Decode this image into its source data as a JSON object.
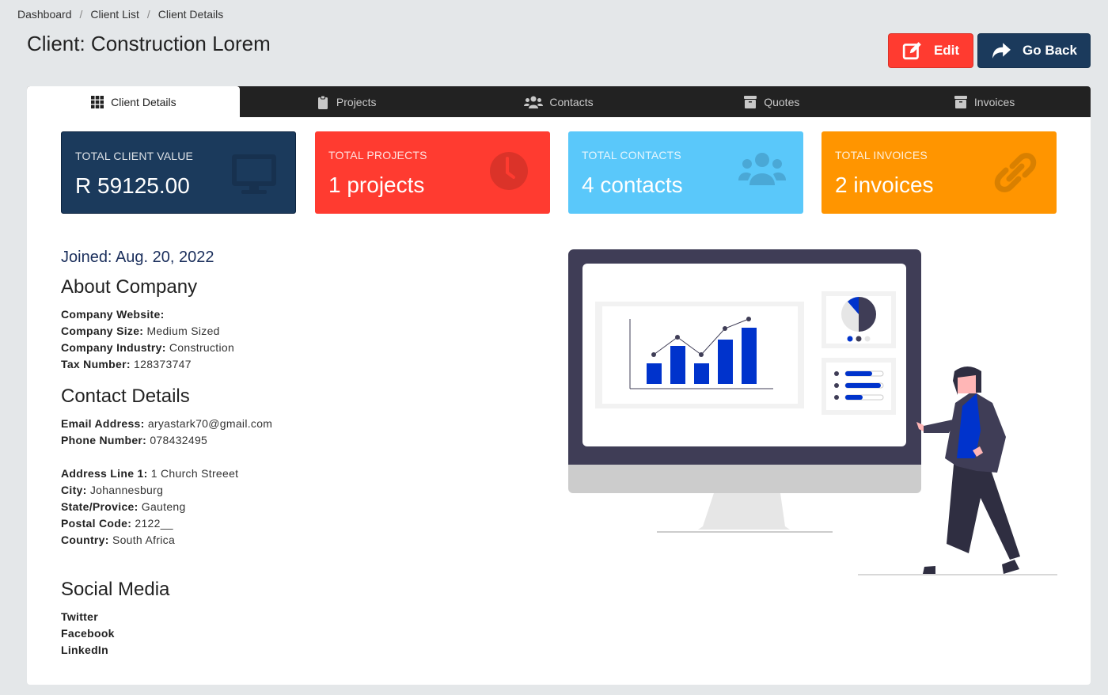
{
  "breadcrumb": {
    "items": [
      "Dashboard",
      "Client List",
      "Client Details"
    ],
    "separator": "/"
  },
  "page_title": "Client: Construction Lorem",
  "actions": {
    "edit_label": "Edit",
    "back_label": "Go Back"
  },
  "tabs": [
    {
      "label": "Client Details",
      "icon": "grid-icon",
      "active": true
    },
    {
      "label": "Projects",
      "icon": "clipboard-icon",
      "active": false
    },
    {
      "label": "Contacts",
      "icon": "users-icon",
      "active": false
    },
    {
      "label": "Quotes",
      "icon": "archive-icon",
      "active": false
    },
    {
      "label": "Invoices",
      "icon": "archive-icon",
      "active": false
    }
  ],
  "stats": [
    {
      "label": "Total Client Value",
      "value": "R 59125.00",
      "icon": "desktop-icon",
      "color": "#1b3a5c"
    },
    {
      "label": "Total Projects",
      "value": "1 projects",
      "icon": "clock-icon",
      "color": "#ff3b30"
    },
    {
      "label": "Total Contacts",
      "value": "4 contacts",
      "icon": "users-icon",
      "color": "#5ac8fa"
    },
    {
      "label": "Total Invoices",
      "value": "2 invoices",
      "icon": "link-icon",
      "color": "#ff9500"
    }
  ],
  "joined": "Joined: Aug. 20, 2022",
  "about": {
    "heading": "About Company",
    "fields": [
      {
        "label": "Company Website:",
        "value": ""
      },
      {
        "label": "Company Size:",
        "value": "Medium Sized"
      },
      {
        "label": "Company Industry:",
        "value": "Construction"
      },
      {
        "label": "Tax Number:",
        "value": "128373747"
      }
    ]
  },
  "contact": {
    "heading": "Contact Details",
    "fields": [
      {
        "label": "Email Address:",
        "value": "aryastark70@gmail.com"
      },
      {
        "label": "Phone Number:",
        "value": "078432495"
      }
    ],
    "address_fields": [
      {
        "label": "Address Line 1:",
        "value": "1 Church Streeet"
      },
      {
        "label": "City:",
        "value": "Johannesburg"
      },
      {
        "label": "State/Provice:",
        "value": "Gauteng"
      },
      {
        "label": "Postal Code:",
        "value": "2122__"
      },
      {
        "label": "Country:",
        "value": "South Africa"
      }
    ]
  },
  "social": {
    "heading": "Social Media",
    "links": [
      "Twitter",
      "Facebook",
      "LinkedIn"
    ]
  },
  "illustration": {
    "name": "dashboard-presentation-illustration",
    "accent": "#0033cc",
    "dark": "#3f3d56"
  }
}
